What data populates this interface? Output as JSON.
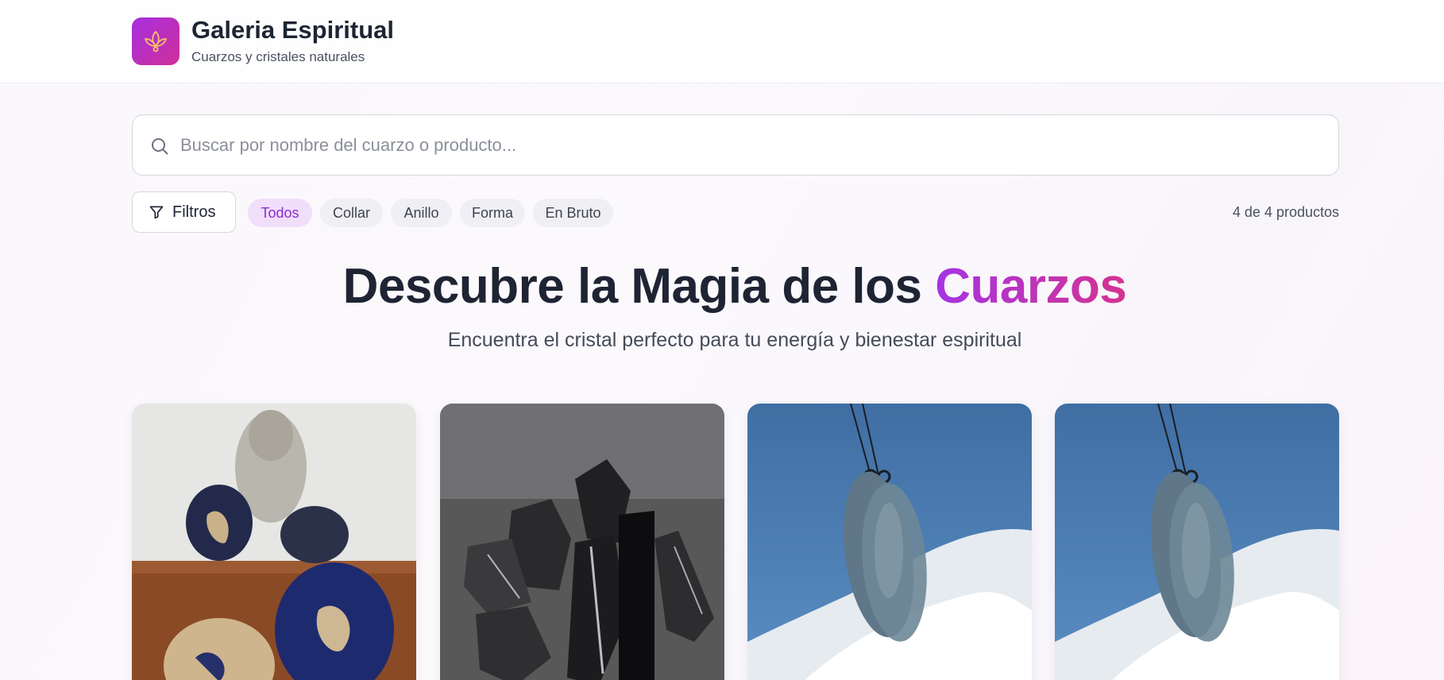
{
  "brand": {
    "title": "Galeria Espiritual",
    "subtitle": "Cuarzos y cristales naturales",
    "logo_icon": "lotus-icon"
  },
  "search": {
    "placeholder": "Buscar por nombre del cuarzo o producto...",
    "value": "",
    "icon": "search-icon"
  },
  "filters": {
    "button_label": "Filtros",
    "button_icon": "filter-icon",
    "chips": [
      {
        "label": "Todos",
        "active": true
      },
      {
        "label": "Collar",
        "active": false
      },
      {
        "label": "Anillo",
        "active": false
      },
      {
        "label": "Forma",
        "active": false
      },
      {
        "label": "En Bruto",
        "active": false
      }
    ],
    "count": "4 de 4 productos"
  },
  "hero": {
    "title_main": "Descubre la Magia de los ",
    "title_accent": "Cuarzos",
    "subtitle": "Encuentra el cristal perfecto para tu energía y bienestar espiritual"
  },
  "products": [
    {
      "image": "sodalite-tumbled-stones"
    },
    {
      "image": "black-tourmaline-raw"
    },
    {
      "image": "blue-pendant-necklace"
    },
    {
      "image": "blue-pendant-necklace"
    }
  ],
  "colors": {
    "accent_purple": "#a534e3",
    "accent_pink": "#d4338f",
    "chip_active_bg": "#f1defb",
    "chip_active_text": "#8a2bc9"
  }
}
